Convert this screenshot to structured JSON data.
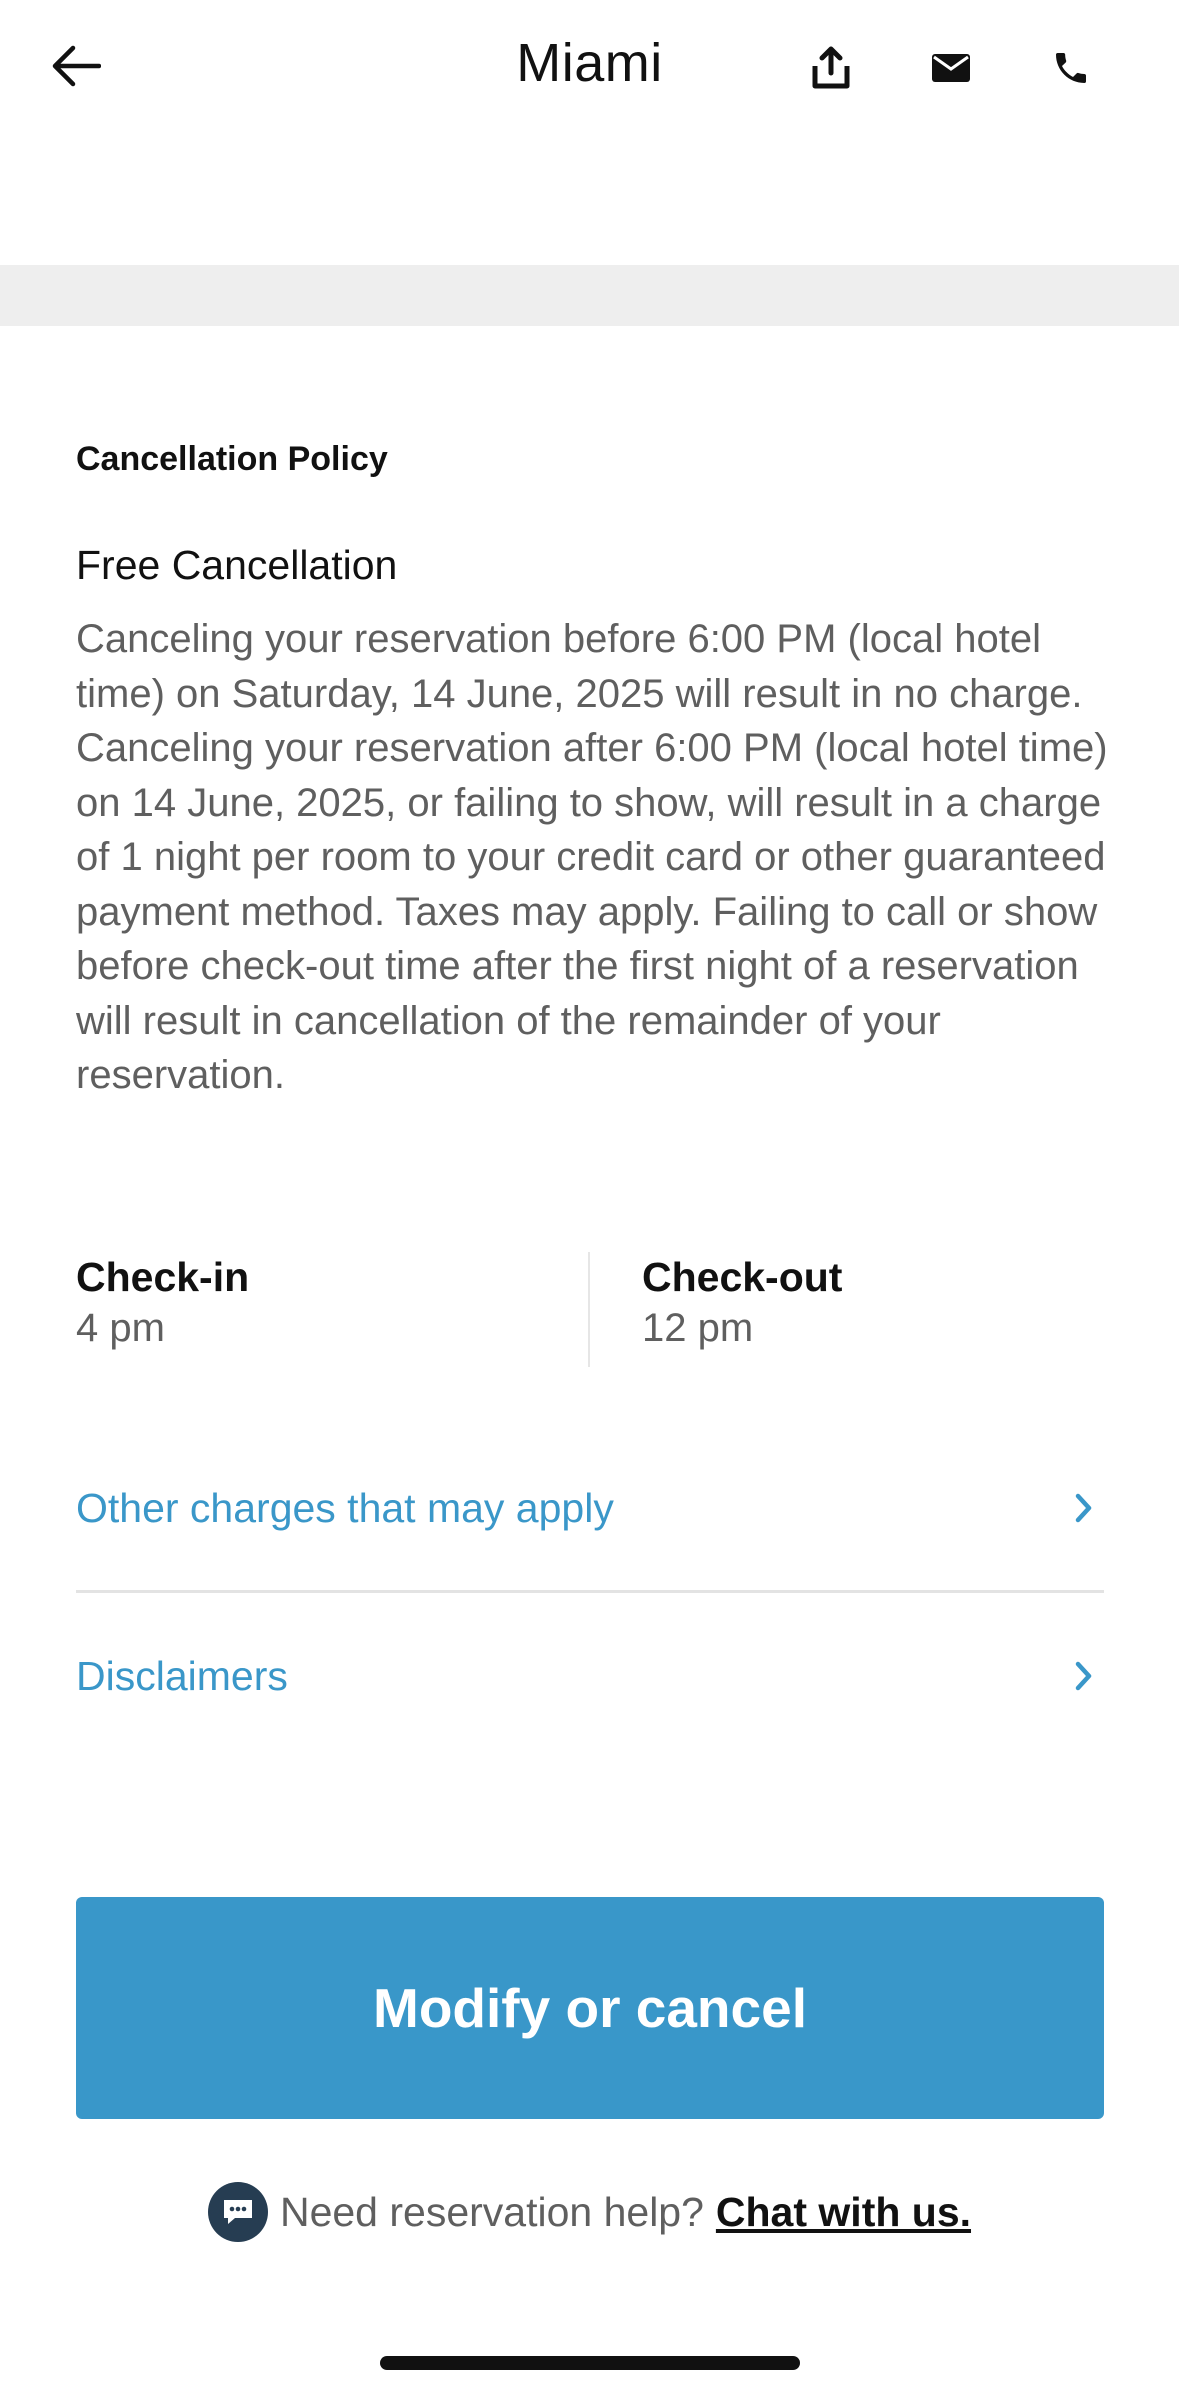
{
  "header": {
    "title": "Miami",
    "icons": [
      "back-arrow-icon",
      "share-icon",
      "mail-icon",
      "phone-icon"
    ]
  },
  "policy": {
    "section_heading": "Cancellation Policy",
    "title": "Free Cancellation",
    "body": "Canceling your reservation before 6:00 PM (local hotel time) on Saturday, 14 June, 2025 will result in no charge. Canceling your reservation after 6:00 PM (local hotel time) on 14 June, 2025, or failing to show, will result in a charge of 1 night per room to your credit card or other guaranteed payment method. Taxes may apply. Failing to call or show before check-out time after the first night of a reservation will result in cancellation of the remainder of your reservation."
  },
  "checkin": {
    "label": "Check-in",
    "value": "4 pm"
  },
  "checkout": {
    "label": "Check-out",
    "value": "12 pm"
  },
  "links": {
    "other_charges": "Other charges that may apply",
    "disclaimers": "Disclaimers"
  },
  "actions": {
    "modify_cancel": "Modify or cancel"
  },
  "help": {
    "prompt": "Need reservation help?",
    "chat_link": "Chat with us."
  },
  "colors": {
    "accent": "#3997c9",
    "link": "#3a97c9",
    "chat_badge": "#263d52"
  }
}
